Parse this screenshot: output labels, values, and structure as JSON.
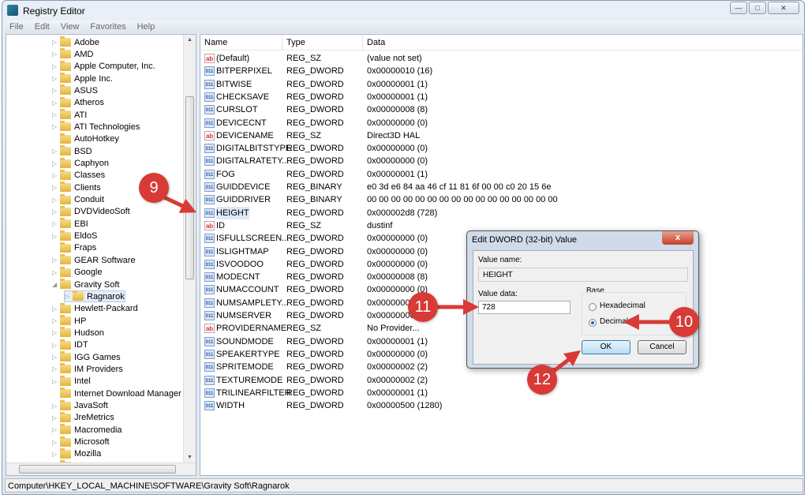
{
  "window": {
    "title": "Registry Editor",
    "controls": [
      "minimize",
      "maximize",
      "close"
    ]
  },
  "menu": [
    "File",
    "Edit",
    "View",
    "Favorites",
    "Help"
  ],
  "tree": {
    "items": [
      {
        "label": "Adobe",
        "expand": "collapsed"
      },
      {
        "label": "AMD",
        "expand": "collapsed"
      },
      {
        "label": "Apple Computer, Inc.",
        "expand": "collapsed"
      },
      {
        "label": "Apple Inc.",
        "expand": "collapsed"
      },
      {
        "label": "ASUS",
        "expand": "collapsed"
      },
      {
        "label": "Atheros",
        "expand": "collapsed"
      },
      {
        "label": "ATI",
        "expand": "collapsed"
      },
      {
        "label": "ATI Technologies",
        "expand": "collapsed"
      },
      {
        "label": "AutoHotkey",
        "expand": "none"
      },
      {
        "label": "BSD",
        "expand": "collapsed"
      },
      {
        "label": "Caphyon",
        "expand": "collapsed"
      },
      {
        "label": "Classes",
        "expand": "collapsed"
      },
      {
        "label": "Clients",
        "expand": "collapsed"
      },
      {
        "label": "Conduit",
        "expand": "collapsed"
      },
      {
        "label": "DVDVideoSoft",
        "expand": "collapsed"
      },
      {
        "label": "EBI",
        "expand": "collapsed"
      },
      {
        "label": "EldoS",
        "expand": "collapsed"
      },
      {
        "label": "Fraps",
        "expand": "none"
      },
      {
        "label": "GEAR Software",
        "expand": "collapsed"
      },
      {
        "label": "Google",
        "expand": "collapsed"
      },
      {
        "label": "Gravity Soft",
        "expand": "expanded"
      },
      {
        "label": "Ragnarok",
        "expand": "collapsed",
        "child": true,
        "selected": true
      },
      {
        "label": "Hewlett-Packard",
        "expand": "collapsed"
      },
      {
        "label": "HP",
        "expand": "collapsed"
      },
      {
        "label": "Hudson",
        "expand": "collapsed"
      },
      {
        "label": "IDT",
        "expand": "collapsed"
      },
      {
        "label": "IGG Games",
        "expand": "collapsed"
      },
      {
        "label": "IM Providers",
        "expand": "collapsed"
      },
      {
        "label": "Intel",
        "expand": "collapsed"
      },
      {
        "label": "Internet Download Manager",
        "expand": "none"
      },
      {
        "label": "JavaSoft",
        "expand": "collapsed"
      },
      {
        "label": "JreMetrics",
        "expand": "collapsed"
      },
      {
        "label": "Macromedia",
        "expand": "collapsed"
      },
      {
        "label": "Microsoft",
        "expand": "collapsed"
      },
      {
        "label": "Mozilla",
        "expand": "collapsed"
      },
      {
        "label": "mozilla.org",
        "expand": "collapsed"
      }
    ]
  },
  "list": {
    "headers": [
      "Name",
      "Type",
      "Data"
    ],
    "rows": [
      {
        "icon": "string",
        "name": "(Default)",
        "type": "REG_SZ",
        "data": "(value not set)"
      },
      {
        "icon": "binary",
        "name": "BITPERPIXEL",
        "type": "REG_DWORD",
        "data": "0x00000010 (16)"
      },
      {
        "icon": "binary",
        "name": "BITWISE",
        "type": "REG_DWORD",
        "data": "0x00000001 (1)"
      },
      {
        "icon": "binary",
        "name": "CHECKSAVE",
        "type": "REG_DWORD",
        "data": "0x00000001 (1)"
      },
      {
        "icon": "binary",
        "name": "CURSLOT",
        "type": "REG_DWORD",
        "data": "0x00000008 (8)"
      },
      {
        "icon": "binary",
        "name": "DEVICECNT",
        "type": "REG_DWORD",
        "data": "0x00000000 (0)"
      },
      {
        "icon": "string",
        "name": "DEVICENAME",
        "type": "REG_SZ",
        "data": "Direct3D HAL"
      },
      {
        "icon": "binary",
        "name": "DIGITALBITSTYPE",
        "type": "REG_DWORD",
        "data": "0x00000000 (0)"
      },
      {
        "icon": "binary",
        "name": "DIGITALRATETY...",
        "type": "REG_DWORD",
        "data": "0x00000000 (0)"
      },
      {
        "icon": "binary",
        "name": "FOG",
        "type": "REG_DWORD",
        "data": "0x00000001 (1)"
      },
      {
        "icon": "binary",
        "name": "GUIDDEVICE",
        "type": "REG_BINARY",
        "data": "e0 3d e6 84 aa 46 cf 11 81 6f 00 00 c0 20 15 6e"
      },
      {
        "icon": "binary",
        "name": "GUIDDRIVER",
        "type": "REG_BINARY",
        "data": "00 00 00 00 00 00 00 00 00 00 00 00 00 00 00 00"
      },
      {
        "icon": "binary",
        "name": "HEIGHT",
        "type": "REG_DWORD",
        "data": "0x000002d8 (728)",
        "selected": true
      },
      {
        "icon": "string",
        "name": "ID",
        "type": "REG_SZ",
        "data": "dustinf"
      },
      {
        "icon": "binary",
        "name": "ISFULLSCREEN...",
        "type": "REG_DWORD",
        "data": "0x00000000 (0)"
      },
      {
        "icon": "binary",
        "name": "ISLIGHTMAP",
        "type": "REG_DWORD",
        "data": "0x00000000 (0)"
      },
      {
        "icon": "binary",
        "name": "ISVOODOO",
        "type": "REG_DWORD",
        "data": "0x00000000 (0)"
      },
      {
        "icon": "binary",
        "name": "MODECNT",
        "type": "REG_DWORD",
        "data": "0x00000008 (8)"
      },
      {
        "icon": "binary",
        "name": "NUMACCOUNT",
        "type": "REG_DWORD",
        "data": "0x00000000 (0)"
      },
      {
        "icon": "binary",
        "name": "NUMSAMPLETY...",
        "type": "REG_DWORD",
        "data": "0x00000002 (2)"
      },
      {
        "icon": "binary",
        "name": "NUMSERVER",
        "type": "REG_DWORD",
        "data": "0x00000000 (0)"
      },
      {
        "icon": "string",
        "name": "PROVIDERNAME",
        "type": "REG_SZ",
        "data": "No Provider..."
      },
      {
        "icon": "binary",
        "name": "SOUNDMODE",
        "type": "REG_DWORD",
        "data": "0x00000001 (1)"
      },
      {
        "icon": "binary",
        "name": "SPEAKERTYPE",
        "type": "REG_DWORD",
        "data": "0x00000000 (0)"
      },
      {
        "icon": "binary",
        "name": "SPRITEMODE",
        "type": "REG_DWORD",
        "data": "0x00000002 (2)"
      },
      {
        "icon": "binary",
        "name": "TEXTUREMODE",
        "type": "REG_DWORD",
        "data": "0x00000002 (2)"
      },
      {
        "icon": "binary",
        "name": "TRILINEARFILTER",
        "type": "REG_DWORD",
        "data": "0x00000001 (1)"
      },
      {
        "icon": "binary",
        "name": "WIDTH",
        "type": "REG_DWORD",
        "data": "0x00000500 (1280)"
      }
    ]
  },
  "status": "Computer\\HKEY_LOCAL_MACHINE\\SOFTWARE\\Gravity Soft\\Ragnarok",
  "dialog": {
    "title": "Edit DWORD (32-bit) Value",
    "close": "x",
    "value_name_label": "Value name:",
    "value_name": "HEIGHT",
    "value_data_label": "Value data:",
    "value_data": "728",
    "base_label": "Base",
    "hex_label": "Hexadecimal",
    "dec_label": "Decimal",
    "selected_base": "Decimal",
    "ok": "OK",
    "cancel": "Cancel"
  },
  "annotations": {
    "step9": "9",
    "step10": "10",
    "step11": "11",
    "step12": "12",
    "color": "#d83a35"
  }
}
